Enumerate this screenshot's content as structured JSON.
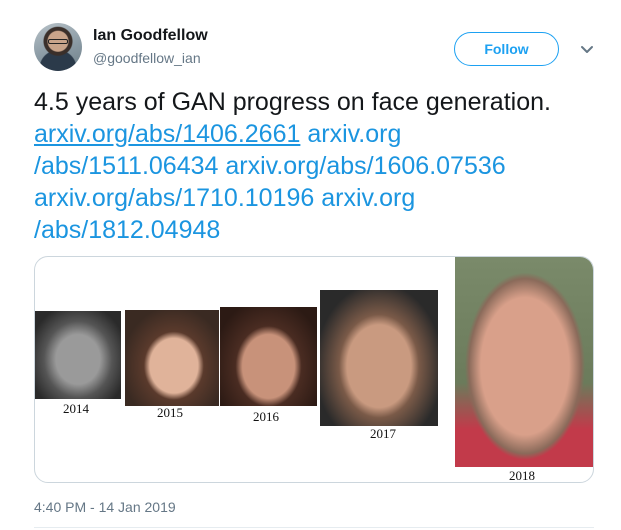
{
  "author": {
    "display_name": "Ian Goodfellow",
    "handle": "@goodfellow_ian"
  },
  "actions": {
    "follow_label": "Follow",
    "menu_icon": "chevron-down-icon"
  },
  "tweet": {
    "text": "4.5 years of GAN progress on face generation.",
    "links": [
      "arxiv.org/abs/1406.2661",
      "arxiv.org",
      "/abs/1511.06434",
      "arxiv.org/abs/1606.07536",
      "arxiv.org/abs/1710.10196",
      "arxiv.org",
      "/abs/1812.04948"
    ]
  },
  "media": {
    "years": [
      "2014",
      "2015",
      "2016",
      "2017",
      "2018"
    ]
  },
  "meta": {
    "timestamp": "4:40 PM - 14 Jan 2019"
  },
  "colors": {
    "link": "#1b95e0",
    "accent": "#1da1f2",
    "muted": "#657786"
  }
}
